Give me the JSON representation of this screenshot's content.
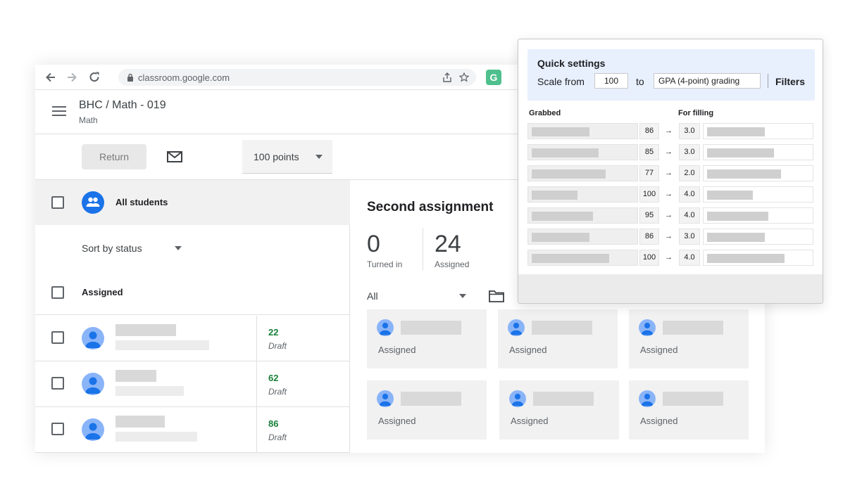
{
  "browser": {
    "url": "classroom.google.com",
    "extension_letter": "G",
    "icons": [
      "back-arrow-icon",
      "forward-arrow-icon",
      "reload-icon",
      "lock-icon",
      "share-icon",
      "star-icon"
    ]
  },
  "header": {
    "course_title": "BHC / Math - 019",
    "course_subtitle": "Math"
  },
  "toolbar": {
    "return_label": "Return",
    "points_value": "100 points"
  },
  "roster": {
    "all_students_label": "All students",
    "sort_label": "Sort by status",
    "assigned_group_label": "Assigned",
    "students": [
      {
        "grade": "22",
        "status": "Draft"
      },
      {
        "grade": "62",
        "status": "Draft"
      },
      {
        "grade": "86",
        "status": "Draft"
      }
    ]
  },
  "assignment": {
    "title": "Second assignment",
    "turned_in_count": "0",
    "turned_in_label": "Turned in",
    "assigned_count": "24",
    "assigned_label": "Assigned",
    "filter_value": "All",
    "cards": [
      {
        "status": "Assigned"
      },
      {
        "status": "Assigned"
      },
      {
        "status": "Assigned"
      },
      {
        "status": "Assigned"
      },
      {
        "status": "Assigned"
      },
      {
        "status": "Assigned"
      }
    ]
  },
  "quick_settings": {
    "title": "Quick settings",
    "scale_from_label": "Scale from",
    "scale_from_value": "100",
    "to_label": "to",
    "target_scale": "GPA (4-point) grading",
    "filters_label": "Filters",
    "grabbed_label": "Grabbed",
    "filling_label": "For filling",
    "arrow_glyph": "→",
    "rows": [
      {
        "score": "86",
        "gpa": "3.0"
      },
      {
        "score": "85",
        "gpa": "3.0"
      },
      {
        "score": "77",
        "gpa": "2.0"
      },
      {
        "score": "100",
        "gpa": "4.0"
      },
      {
        "score": "95",
        "gpa": "4.0"
      },
      {
        "score": "86",
        "gpa": "3.0"
      },
      {
        "score": "100",
        "gpa": "4.0"
      }
    ]
  },
  "colors": {
    "accent_blue": "#1a73e8",
    "grade_green": "#188038",
    "quick_settings_header": "#e8f0fe",
    "extension_green": "#4fc08d"
  }
}
